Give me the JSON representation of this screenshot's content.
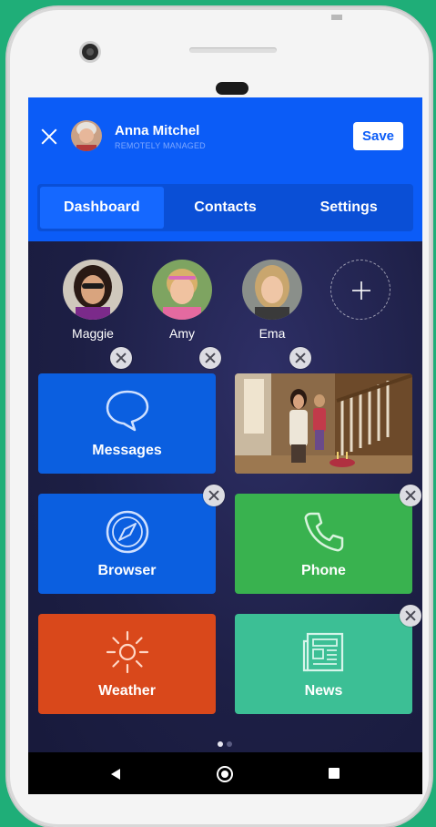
{
  "header": {
    "user_name": "Anna Mitchel",
    "user_status": "REMOTELY MANAGED",
    "save_label": "Save",
    "accent": "#0b5cf7"
  },
  "tabs": [
    {
      "label": "Dashboard",
      "active": true
    },
    {
      "label": "Contacts",
      "active": false
    },
    {
      "label": "Settings",
      "active": false
    }
  ],
  "contacts": [
    {
      "name": "Maggie"
    },
    {
      "name": "Amy"
    },
    {
      "name": "Ema"
    }
  ],
  "tiles": {
    "messages": {
      "label": "Messages",
      "color": "#0b5fe0",
      "icon": "chat-bubble-icon"
    },
    "browser": {
      "label": "Browser",
      "color": "#0b5fe0",
      "icon": "compass-icon"
    },
    "phone": {
      "label": "Phone",
      "color": "#39b24f",
      "icon": "phone-icon"
    },
    "weather": {
      "label": "Weather",
      "color": "#d9481b",
      "icon": "sun-icon"
    },
    "news": {
      "label": "News",
      "color": "#3cbf95",
      "icon": "newspaper-icon"
    }
  },
  "pager": {
    "pages": 2,
    "current": 1
  }
}
